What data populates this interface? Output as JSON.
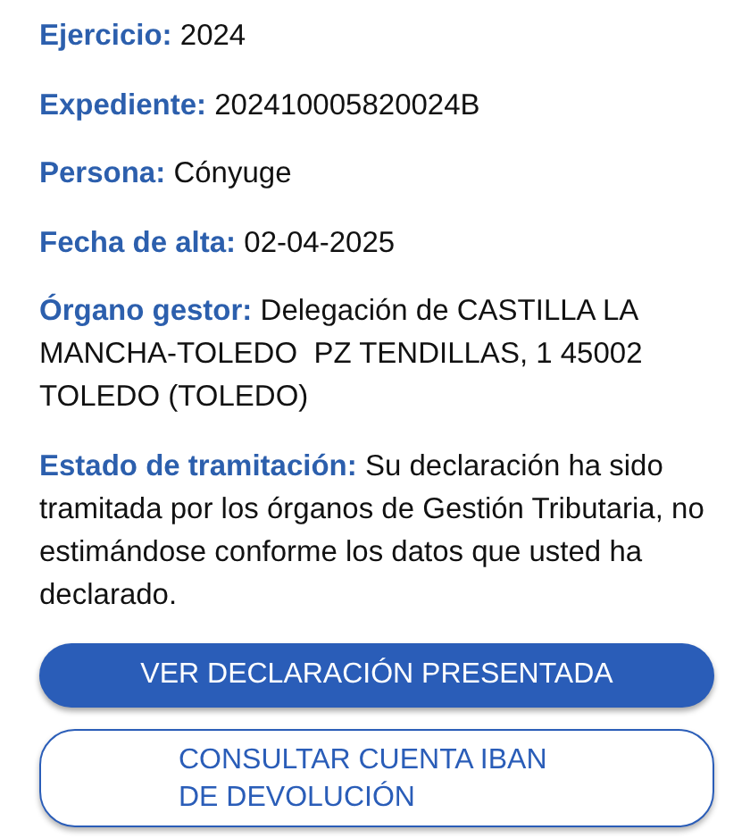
{
  "fields": [
    {
      "label": "Ejercicio:",
      "value": "2024"
    },
    {
      "label": "Expediente:",
      "value": "202410005820024B"
    },
    {
      "label": "Persona:",
      "value": "Cónyuge"
    },
    {
      "label": "Fecha de alta:",
      "value": "02-04-2025"
    },
    {
      "label": "Órgano gestor:",
      "value": "Delegación de CASTILLA LA MANCHA-TOLEDO  PZ TENDILLAS, 1 45002 TOLEDO (TOLEDO)"
    },
    {
      "label": "Estado de tramitación:",
      "value": "Su declaración ha sido tramitada por los órganos de Gestión Tributaria, no estimándose conforme los datos que usted ha declarado."
    }
  ],
  "buttons": [
    {
      "label": "VER DECLARACIÓN PRESENTADA",
      "kind": "filled"
    },
    {
      "label": "CONSULTAR CUENTA IBAN DE DEVOLUCIÓN",
      "kind": "outlined"
    }
  ]
}
